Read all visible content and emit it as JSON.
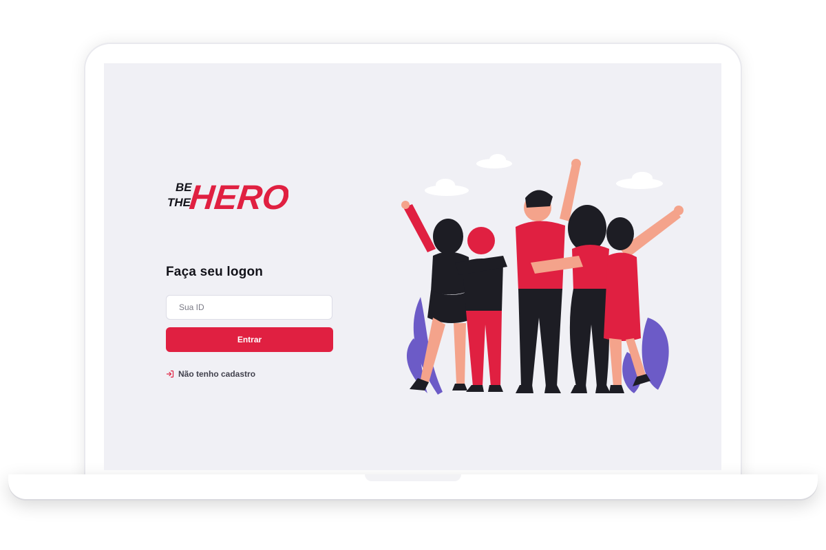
{
  "logo": {
    "line1": "BE",
    "line2": "THE",
    "line3": "HERO",
    "color": "#e02041"
  },
  "login": {
    "title": "Faça seu logon",
    "id_placeholder": "Sua ID",
    "submit_label": "Entrar",
    "register_link": "Não tenho cadastro"
  },
  "colors": {
    "accent": "#e02041",
    "background": "#f0f0f5",
    "text": "#13131a",
    "muted_text": "#41414d"
  },
  "icons": {
    "register_link": "log-in-icon"
  }
}
